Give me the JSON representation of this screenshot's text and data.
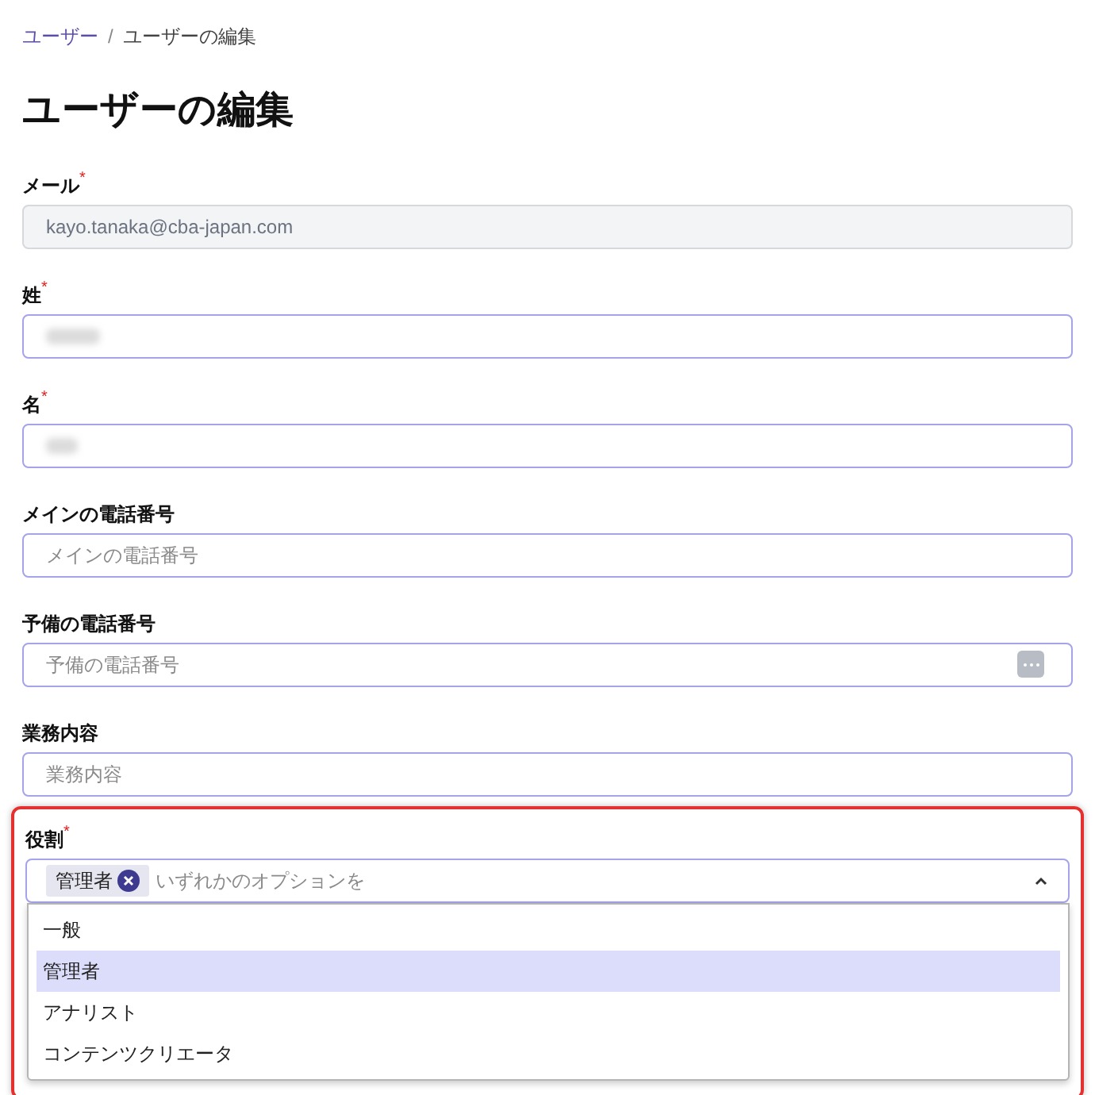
{
  "breadcrumb": {
    "parent": "ユーザー",
    "current": "ユーザーの編集",
    "separator": "/"
  },
  "title": "ユーザーの編集",
  "fields": [
    {
      "label": "メール",
      "required_mark": "*",
      "kind": "disabled",
      "value": "kayo.tanaka@cba-japan.com"
    },
    {
      "label": "姓",
      "required_mark": "*",
      "kind": "redacted"
    },
    {
      "label": "名",
      "required_mark": "*",
      "kind": "redacted"
    },
    {
      "label": "メインの電話番号",
      "kind": "text",
      "placeholder": "メインの電話番号"
    },
    {
      "label": "予備の電話番号",
      "kind": "text",
      "placeholder": "予備の電話番号",
      "autofill_icon": true
    },
    {
      "label": "業務内容",
      "kind": "text",
      "placeholder": "業務内容"
    }
  ],
  "role": {
    "label": "役割",
    "required_mark": "*",
    "highlighted": true,
    "chips": [
      "管理者"
    ],
    "placeholder": "いずれかのオプションを",
    "expanded": true,
    "options": [
      {
        "label": "一般",
        "selected": false
      },
      {
        "label": "管理者",
        "selected": true
      },
      {
        "label": "アナリスト",
        "selected": false
      },
      {
        "label": "コンテンツクリエータ",
        "selected": false
      }
    ]
  }
}
